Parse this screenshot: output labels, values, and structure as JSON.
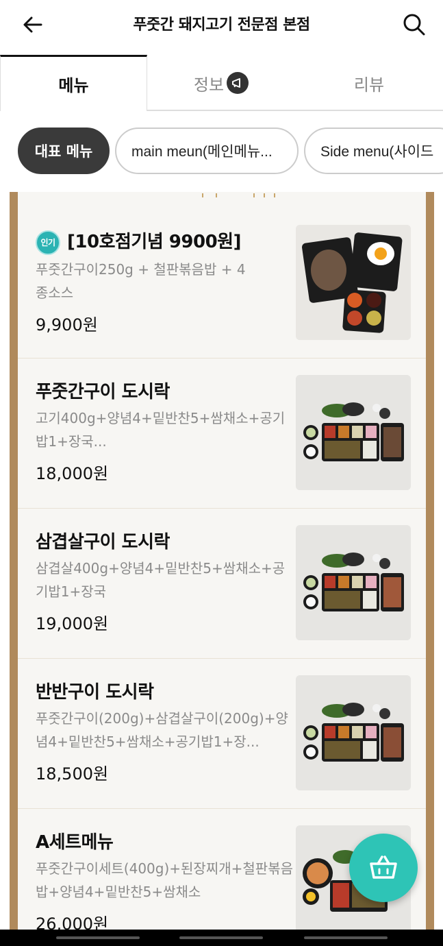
{
  "header": {
    "title": "푸줏간 돼지고기 전문점 본점",
    "back_icon": "arrow-left-icon",
    "search_icon": "search-icon"
  },
  "tabs": [
    {
      "label": "메뉴",
      "active": true
    },
    {
      "label": "정보",
      "active": false,
      "icon": "megaphone-icon"
    },
    {
      "label": "리뷰",
      "active": false
    }
  ],
  "chips": [
    {
      "label": "대표 메뉴",
      "active": true
    },
    {
      "label": "main meun(메인메뉴...",
      "active": false
    },
    {
      "label": "Side menu(사이드",
      "active": false
    }
  ],
  "menu_items": [
    {
      "name": "[10호점기념 9900원]",
      "badge": "인기",
      "desc": "푸줏간구이250g + 철판볶음밥 + 4종소스",
      "price": "9,900원"
    },
    {
      "name": "푸줏간구이 도시락",
      "desc": "고기400g+양념4+밑반찬5+쌈채소+공기밥1+장국...",
      "price": "18,000원"
    },
    {
      "name": "삼겹살구이 도시락",
      "desc": "삼겹살400g+양념4+밑반찬5+쌈채소+공기밥1+장국",
      "price": "19,000원"
    },
    {
      "name": "반반구이 도시락",
      "desc": "푸줏간구이(200g)+삼겹살구이(200g)+양념4+밑반찬5+쌈채소+공기밥1+장...",
      "price": "18,500원"
    },
    {
      "name": "A세트메뉴",
      "desc": "푸줏간구이세트(400g)+된장찌개+철판볶음밥+양념4+밑반찬5+쌈채소",
      "price": "26,000원"
    }
  ],
  "colors": {
    "accent": "#2ec4b6",
    "frame": "#b08a5c",
    "chip_active": "#3a3a3a"
  },
  "cart_icon": "basket-icon"
}
